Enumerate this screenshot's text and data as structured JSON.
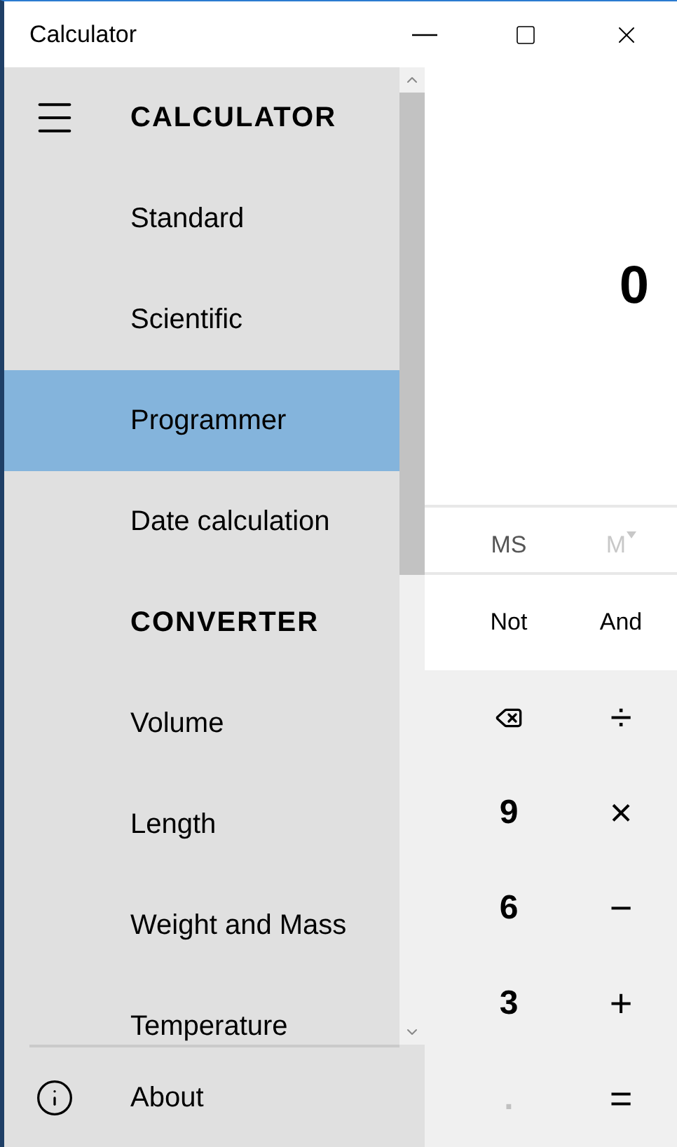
{
  "window": {
    "title": "Calculator"
  },
  "nav": {
    "items": [
      {
        "kind": "header",
        "label": "CALCULATOR"
      },
      {
        "kind": "item",
        "label": "Standard",
        "selected": false
      },
      {
        "kind": "item",
        "label": "Scientific",
        "selected": false
      },
      {
        "kind": "item",
        "label": "Programmer",
        "selected": true
      },
      {
        "kind": "item",
        "label": "Date calculation",
        "selected": false
      },
      {
        "kind": "header",
        "label": "CONVERTER"
      },
      {
        "kind": "item",
        "label": "Volume",
        "selected": false
      },
      {
        "kind": "item",
        "label": "Length",
        "selected": false
      },
      {
        "kind": "item",
        "label": "Weight and Mass",
        "selected": false
      },
      {
        "kind": "item",
        "label": "Temperature",
        "selected": false
      }
    ],
    "footer": {
      "label": "About"
    }
  },
  "display": {
    "value": "0"
  },
  "memory": [
    {
      "label": "MS",
      "disabled": false,
      "dropdown": false
    },
    {
      "label": "M",
      "disabled": true,
      "dropdown": true
    }
  ],
  "logic": [
    {
      "label": "Not"
    },
    {
      "label": "And"
    }
  ],
  "keys": [
    {
      "kind": "backspace",
      "disabled": false
    },
    {
      "kind": "operator",
      "label": "÷",
      "disabled": false
    },
    {
      "kind": "digit",
      "label": "9",
      "disabled": false
    },
    {
      "kind": "operator",
      "label": "×",
      "disabled": false
    },
    {
      "kind": "digit",
      "label": "6",
      "disabled": false
    },
    {
      "kind": "operator",
      "label": "−",
      "disabled": false
    },
    {
      "kind": "digit",
      "label": "3",
      "disabled": false
    },
    {
      "kind": "operator",
      "label": "+",
      "disabled": false
    },
    {
      "kind": "digit",
      "label": ".",
      "disabled": true
    },
    {
      "kind": "operator",
      "label": "=",
      "disabled": false
    }
  ]
}
